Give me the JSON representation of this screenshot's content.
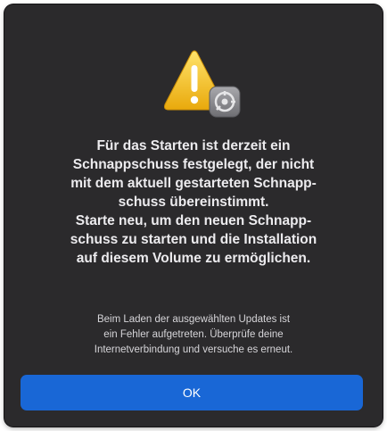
{
  "dialog": {
    "icon": "warning-triangle-icon",
    "badge_icon": "startup-disk-gear-icon",
    "headline": "Für das Starten ist derzeit ein\nSchnappschuss festgelegt, der nicht\nmit dem aktuell gestarteten Schnapp-\nschuss übereinstimmt.\nStarte neu, um den neuen Schnapp-\nschuss zu starten und die Installation\nauf diesem Volume zu ermöglichen.",
    "info": "Beim Laden der ausgewählten Updates ist\nein Fehler aufgetreten. Überprüfe deine\nInternetverbindung und versuche es erneut.",
    "ok_label": "OK"
  },
  "colors": {
    "background": "#2b2a2c",
    "accent": "#1967d6",
    "warning": "#f5c518"
  }
}
